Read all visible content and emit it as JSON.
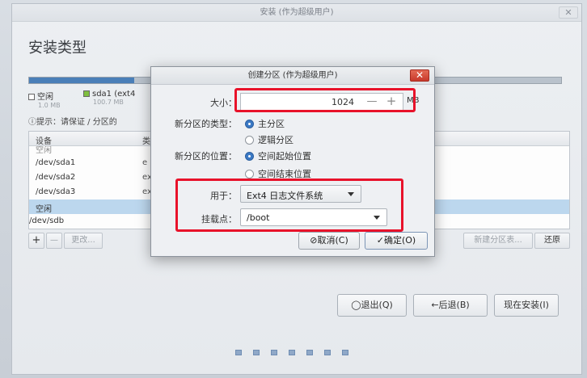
{
  "window": {
    "title": "安装 (作为超级用户)",
    "close_glyph": "✕",
    "page_title": "安装类型"
  },
  "partition_legend": [
    {
      "label": "空闲",
      "size": "1.0 MB",
      "color": "#ffffff"
    },
    {
      "label": "sda1 (ext4",
      "size": "100.7 MB",
      "color": "#7fbf3f"
    }
  ],
  "hint": "ⓘ提示：请保证 / 分区的",
  "table": {
    "columns": [
      "设备",
      "类"
    ],
    "rows": [
      {
        "device": "空闲",
        "type": ""
      },
      {
        "device": "/dev/sda1",
        "type": "e"
      },
      {
        "device": "/dev/sda2",
        "type": "ex"
      },
      {
        "device": "/dev/sda3",
        "type": "ex"
      },
      {
        "device": "空闲",
        "type": ""
      },
      {
        "device": "/dev/sdb",
        "type": ""
      }
    ]
  },
  "table_toolbar": {
    "add": "+",
    "remove": "—",
    "change": "更改...",
    "new_table": "新建分区表...",
    "revert": "还原"
  },
  "nav": {
    "quit": "◯退出(Q)",
    "back": "←后退(B)",
    "install_now": "现在安装(I)"
  },
  "dialog": {
    "title": "创建分区 (作为超级用户)",
    "close_glyph": "✕",
    "size_label": "大小：",
    "size_value": "1024",
    "size_minus": "—",
    "size_plus": "+",
    "size_unit": "MB",
    "type_label": "新分区的类型：",
    "type_options": [
      "主分区",
      "逻辑分区"
    ],
    "type_selected": 0,
    "location_label": "新分区的位置：",
    "location_options": [
      "空间起始位置",
      "空间结束位置"
    ],
    "location_selected": 0,
    "use_as_label": "用于：",
    "use_as_value": "Ext4 日志文件系统",
    "mount_label": "挂载点：",
    "mount_value": "/boot",
    "cancel": "⊘取消(C)",
    "ok": "✓确定(O)"
  },
  "colors": {
    "highlight": "#e8122a",
    "accent": "#3b79c4",
    "selected_row": "#bcd7ee"
  }
}
